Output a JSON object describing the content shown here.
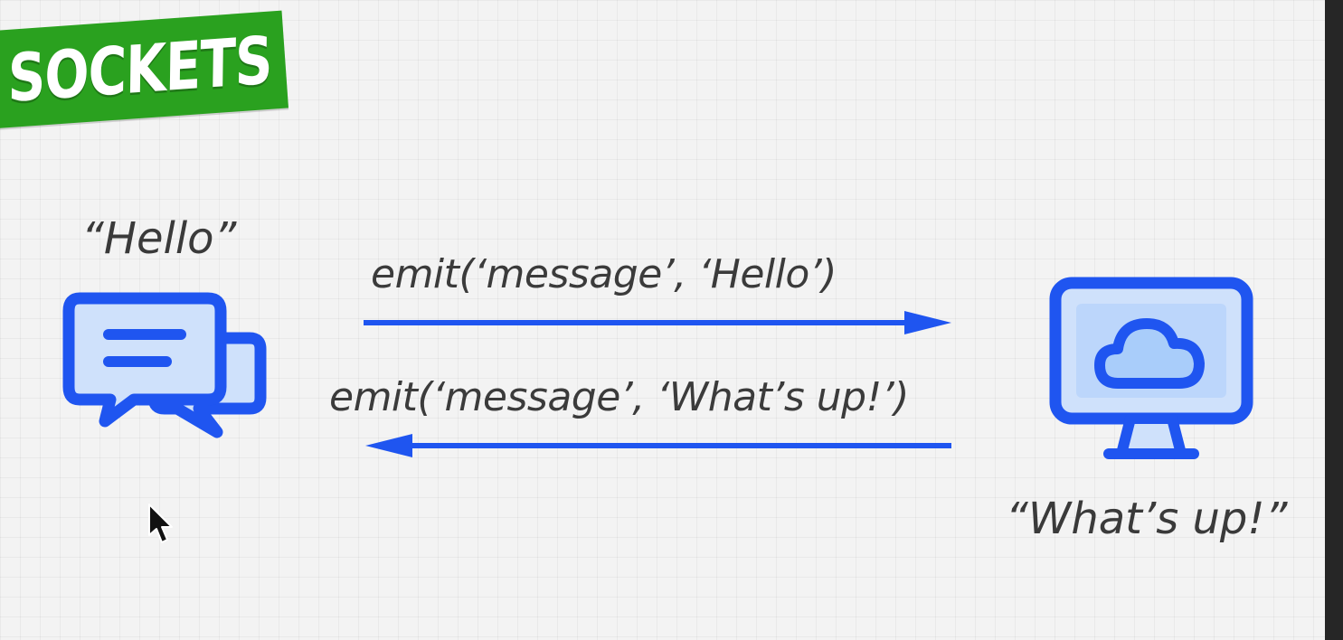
{
  "title": "SOCKETS",
  "left_node": {
    "quote": "“Hello”",
    "icon": "chat-bubbles-icon"
  },
  "right_node": {
    "quote": "“What’s up!”",
    "icon": "monitor-cloud-icon"
  },
  "messages": {
    "to_server": "emit(‘message’, ‘Hello’)",
    "to_client": "emit(‘message’, ‘What’s up!’)"
  },
  "colors": {
    "banner": "#2aa11f",
    "accent": "#1f55f0",
    "icon_fill": "#cfe1fb",
    "icon_fill_light": "#a9cdfa",
    "text": "#3a3a3a"
  }
}
